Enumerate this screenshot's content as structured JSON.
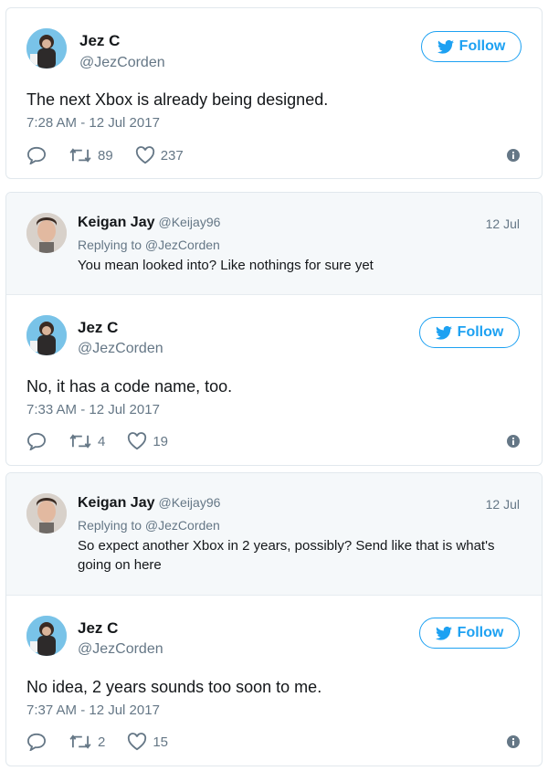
{
  "follow_label": "Follow",
  "colors": {
    "accent": "#1da1f2",
    "muted": "#657786",
    "text": "#14171a",
    "reply_bg": "#f5f8fa"
  },
  "tweets": [
    {
      "author": {
        "name": "Jez C",
        "handle": "@JezCorden"
      },
      "text": "The next Xbox is already being designed.",
      "timestamp": "7:28 AM - 12 Jul 2017",
      "retweets": "89",
      "likes": "237"
    },
    {
      "reply": {
        "name": "Keigan Jay",
        "handle": "@Keijay96",
        "date": "12 Jul",
        "replying_to": "Replying to @JezCorden",
        "text": "You mean looked into? Like nothings for sure yet"
      },
      "author": {
        "name": "Jez C",
        "handle": "@JezCorden"
      },
      "text": "No, it has a code name, too.",
      "timestamp": "7:33 AM - 12 Jul 2017",
      "retweets": "4",
      "likes": "19"
    },
    {
      "reply": {
        "name": "Keigan Jay",
        "handle": "@Keijay96",
        "date": "12 Jul",
        "replying_to": "Replying to @JezCorden",
        "text": "So expect another Xbox in 2 years, possibly? Send like that is what's going on here"
      },
      "author": {
        "name": "Jez C",
        "handle": "@JezCorden"
      },
      "text": "No idea, 2 years sounds too soon to me.",
      "timestamp": "7:37 AM - 12 Jul 2017",
      "retweets": "2",
      "likes": "15"
    }
  ],
  "icons": {
    "reply": "reply-icon",
    "retweet": "retweet-icon",
    "like": "heart-icon",
    "info": "info-icon",
    "bird": "twitter-bird-icon"
  }
}
